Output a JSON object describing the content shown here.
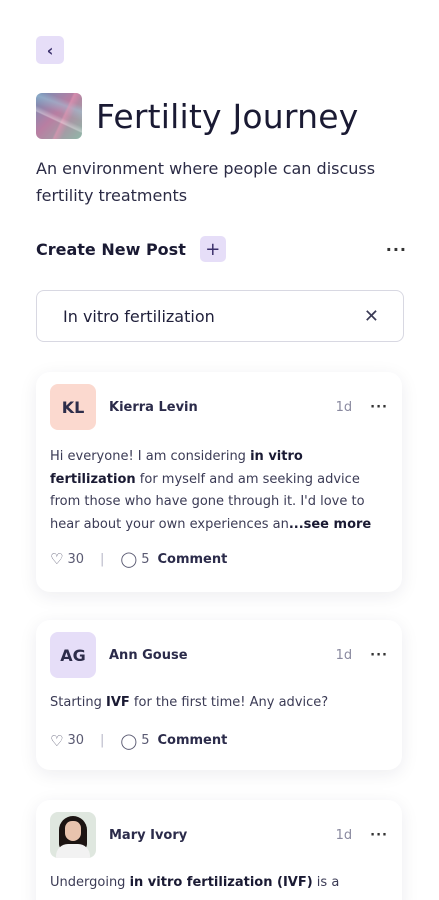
{
  "nav": {
    "back_icon": "chevron-left-icon",
    "back_glyph": "‹"
  },
  "group": {
    "title": "Fertility Journey",
    "description": "An environment where people can discuss fertility treatments"
  },
  "create_post": {
    "label": "Create New Post",
    "plus_glyph": "+",
    "more_glyph": "···"
  },
  "search": {
    "value": "In vitro fertilization",
    "clear_glyph": "✕"
  },
  "posts": [
    {
      "initials": "KL",
      "avatar_color": "#fbd9cf",
      "author": "Kierra Levin",
      "age": "1d",
      "body_parts": [
        "Hi everyone! I am considering ",
        "in vitro fertilization",
        " for myself and am seeking advice from those who have gone through it. I'd love to hear about your own experiences an",
        "...see more"
      ],
      "likes": "30",
      "comments": "5",
      "comment_label": "Comment"
    },
    {
      "initials": "AG",
      "avatar_color": "#e6def8",
      "author": "Ann Gouse",
      "age": "1d",
      "body_parts": [
        "Starting ",
        "IVF",
        " for the first time! Any advice?"
      ],
      "likes": "30",
      "comments": "5",
      "comment_label": "Comment"
    },
    {
      "author": "Mary Ivory",
      "age": "1d",
      "body_parts": [
        "Undergoing ",
        "in vitro fertilization (IVF)",
        " is a"
      ]
    }
  ],
  "more_glyph": "···",
  "like_glyph": "♡",
  "comment_glyph": "◯"
}
